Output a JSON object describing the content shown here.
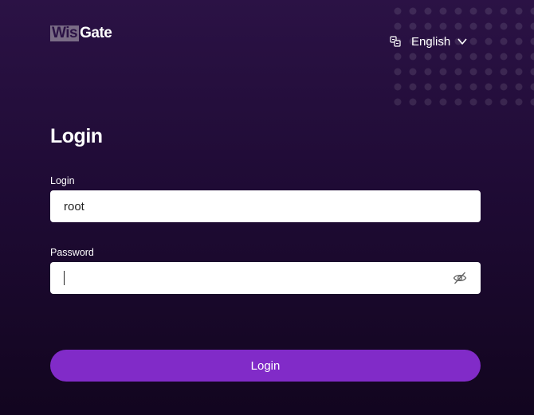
{
  "brand": {
    "logo_part1": "Wis",
    "logo_part2": "Gate"
  },
  "language": {
    "selected": "English",
    "icon": "translate-icon",
    "dropdown_icon": "chevron-down-icon"
  },
  "form": {
    "title": "Login",
    "login_label": "Login",
    "login_value": "root",
    "password_label": "Password",
    "password_value": "",
    "password_toggle_icon": "eye-off-icon",
    "submit_label": "Login"
  },
  "colors": {
    "background_top": "#2b1245",
    "background_bottom": "#12051f",
    "accent": "#812bc8",
    "input_bg": "#ffffff"
  }
}
